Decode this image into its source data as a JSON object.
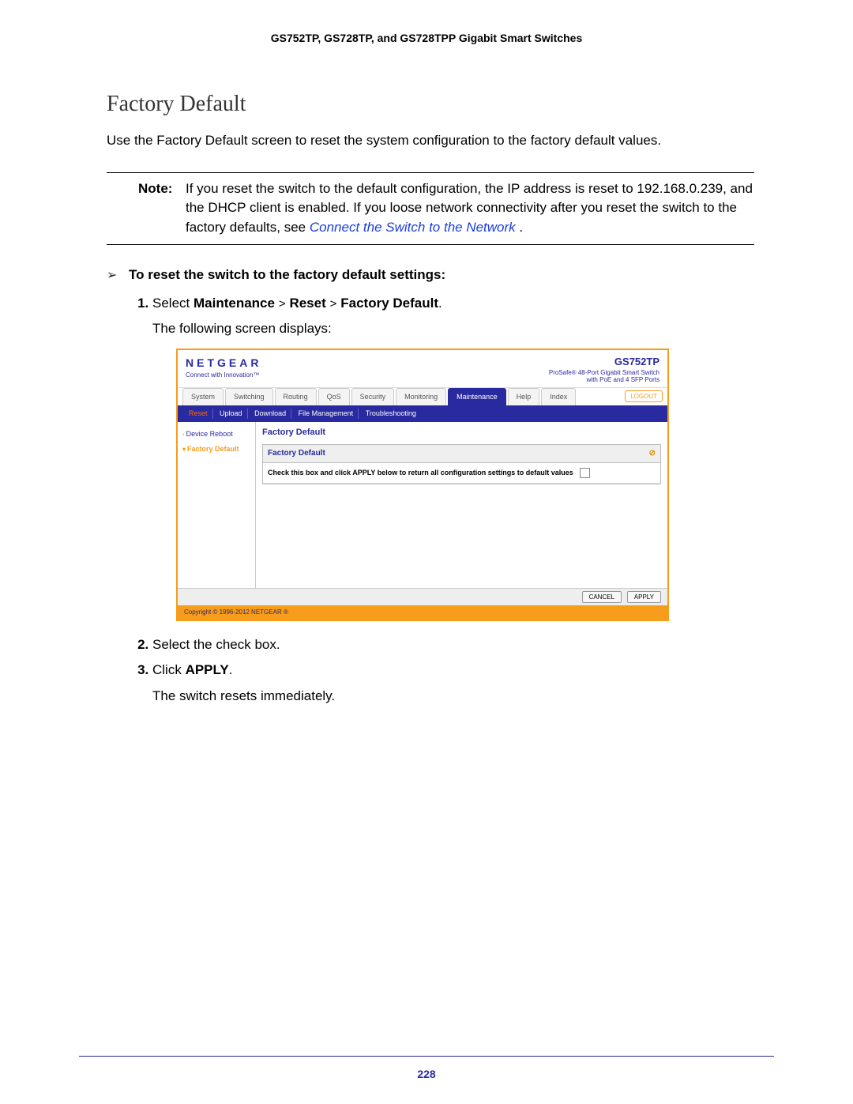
{
  "header": "GS752TP, GS728TP, and GS728TPP Gigabit Smart Switches",
  "h1": "Factory Default",
  "intro": "Use the Factory Default screen to reset the system configuration to the factory default values.",
  "note": {
    "label": "Note:",
    "body_pre": "If you reset the switch to the default configuration, the IP address is reset to 192.168.0.239, and the DHCP client is enabled. If you loose network connectivity after you reset the switch to the factory defaults, see ",
    "link": "Connect the Switch to the Network",
    "body_post": " ."
  },
  "proc_title": "To reset the switch to the factory default settings:",
  "steps": {
    "s1_pre": "Select ",
    "s1_b1": "Maintenance",
    "s1_b2": "Reset",
    "s1_b3": "Factory Default",
    "s1_post": ".",
    "s1_sub": "The following screen displays:",
    "s2": "Select the check box.",
    "s3_pre": "Click ",
    "s3_b": "APPLY",
    "s3_post": ".",
    "s3_sub": "The switch resets immediately."
  },
  "shot": {
    "brand": "NETGEAR",
    "tagline": "Connect with Innovation™",
    "model": "GS752TP",
    "model_sub1": "ProSafe® 48-Port Gigabit Smart Switch",
    "model_sub2": "with PoE and 4 SFP Ports",
    "tabs": [
      "System",
      "Switching",
      "Routing",
      "QoS",
      "Security",
      "Monitoring",
      "Maintenance",
      "Help",
      "Index"
    ],
    "active_tab": "Maintenance",
    "logout": "LOGOUT",
    "subtabs": [
      "Reset",
      "Upload",
      "Download",
      "File Management",
      "Troubleshooting"
    ],
    "active_subtab": "Reset",
    "side": {
      "item1": "Device Reboot",
      "item2": "Factory Default"
    },
    "panel_title": "Factory Default",
    "panel_header": "Factory Default",
    "panel_row": "Check this box and click APPLY below to return all configuration settings to default values",
    "cancel": "CANCEL",
    "apply": "APPLY",
    "copyright": "Copyright © 1996-2012 NETGEAR ®"
  },
  "page_number": "228"
}
